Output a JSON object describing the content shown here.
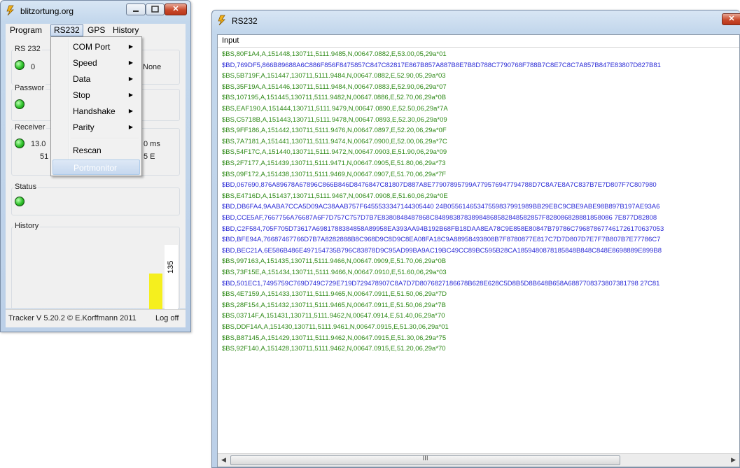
{
  "main_window": {
    "title": "blitzortung.org",
    "menu": [
      "Program",
      "RS232",
      "GPS",
      "History"
    ],
    "groups": {
      "rs232": {
        "label": "RS 232",
        "value_partial": "0",
        "value_right": "None"
      },
      "password": {
        "label": "Passwor"
      },
      "receiver": {
        "label": "Receiver",
        "line1_left": "13.0",
        "line1_right": "0 ms",
        "line2_left": "51",
        "line2_right": "5 E"
      },
      "status": {
        "label": "Status"
      },
      "history": {
        "label": "History",
        "bar_value": "135"
      }
    },
    "status_bar": {
      "version": "Tracker V 5.20.2 © E.Korffmann 2011",
      "logoff": "Log off"
    }
  },
  "rs232_menu": [
    {
      "label": "COM Port",
      "submenu": true
    },
    {
      "label": "Speed",
      "submenu": true
    },
    {
      "label": "Data",
      "submenu": true
    },
    {
      "label": "Stop",
      "submenu": true
    },
    {
      "label": "Handshake",
      "submenu": true
    },
    {
      "label": "Parity",
      "submenu": true
    },
    {
      "label": "Rescan",
      "submenu": false
    },
    {
      "label": "Portmonitor",
      "submenu": false,
      "highlighted": true
    }
  ],
  "port_monitor": {
    "title": "RS232",
    "column_header": "Input",
    "lines": [
      {
        "type": "BS",
        "text": "$BS,80F1A4,A,151448,130711,5111.9485,N,00647.0882,E,53.00,05,29a*01"
      },
      {
        "type": "BD",
        "text": "$BD,769DF5,866B89688A6C886F856F8475857C847C82817E867B857A887B8E7B8D788C7790768F788B7C8E7C8C7A857B847E83807D827B81"
      },
      {
        "type": "BS",
        "text": "$BS,5B719F,A,151447,130711,5111.9484,N,00647.0882,E,52.90,05,29a*03"
      },
      {
        "type": "BS",
        "text": "$BS,35F19A,A,151446,130711,5111.9484,N,00647.0883,E,52.90,06,29a*07"
      },
      {
        "type": "BS",
        "text": "$BS,107195,A,151445,130711,5111.9482,N,00647.0886,E,52.70,06,29a*0B"
      },
      {
        "type": "BS",
        "text": "$BS,EAF190,A,151444,130711,5111.9479,N,00647.0890,E,52.50,06,29a*7A"
      },
      {
        "type": "BS",
        "text": "$BS,C5718B,A,151443,130711,5111.9478,N,00647.0893,E,52.30,06,29a*09"
      },
      {
        "type": "BS",
        "text": "$BS,9FF186,A,151442,130711,5111.9476,N,00647.0897,E,52.20,06,29a*0F"
      },
      {
        "type": "BS",
        "text": "$BS,7A7181,A,151441,130711,5111.9474,N,00647.0900,E,52.00,06,29a*7C"
      },
      {
        "type": "BS",
        "text": "$BS,54F17C,A,151440,130711,5111.9472,N,00647.0903,E,51.90,06,29a*09"
      },
      {
        "type": "BS",
        "text": "$BS,2F7177,A,151439,130711,5111.9471,N,00647.0905,E,51.80,06,29a*73"
      },
      {
        "type": "BS",
        "text": "$BS,09F172,A,151438,130711,5111.9469,N,00647.0907,E,51.70,06,29a*7F"
      },
      {
        "type": "BD",
        "text": "$BD,067690,876A89678A67896C866B846D8476847C81807D887A8E77907895799A779576947794788D7C8A7E8A7C837B7E7D807F7C807980"
      },
      {
        "type": "BS",
        "text": "$BS,E4716D,A,151437,130711,5111.9467,N,00647.0908,E,51.60,06,29a*0E"
      },
      {
        "type": "BD",
        "text": "$BD,DB6FA4,9AABA7CCA5D09AC38AAB757F6455533347144305440 24B05561465347559837991989BB29EBC9CBE9ABE98B897B197AE93A6"
      },
      {
        "type": "BD",
        "text": "$BD,CCE5AF,7667756A76687A6F7D757C757D7B7E8380848487868C84898387838984868582848582857F828086828881858086 7E877D82808"
      },
      {
        "type": "BD",
        "text": "$BD,C2F584,705F705D73617A6981788384858A89958EA393AA94B192B68FB18DAA8EA78C9E858E80847B79786C796878677461726170637053"
      },
      {
        "type": "BD",
        "text": "$BD,BFE94A,76687467766D7B7A8282888B8C968D9C8D9C8EA08FA18C9A88958493808B7F8780877E817C7D7D807D7E7F7B807B7E77786C7"
      },
      {
        "type": "BD",
        "text": "$BD,BEC21A,6E586B486E497154735B796C83878D9C95AD99BA9AC19BC49CC89BC595B28CA1859480878185848B848C848E8698889E899B8"
      },
      {
        "type": "BS",
        "text": "$BS,997163,A,151435,130711,5111.9466,N,00647.0909,E,51.70,06,29a*0B"
      },
      {
        "type": "BS",
        "text": "$BS,73F15E,A,151434,130711,5111.9466,N,00647.0910,E,51.60,06,29a*03"
      },
      {
        "type": "BD",
        "text": "$BD,501EC1,7495759C769D749C729E719D729478907C8A7D7D8076827186678B628E628C5D8B5D8B648B658A6887708373807381798 27C81"
      },
      {
        "type": "BS",
        "text": "$BS,4E7159,A,151433,130711,5111.9465,N,00647.0911,E,51.50,06,29a*7D"
      },
      {
        "type": "BS",
        "text": "$BS,28F154,A,151432,130711,5111.9465,N,00647.0911,E,51.50,06,29a*7B"
      },
      {
        "type": "BS",
        "text": "$BS,03714F,A,151431,130711,5111.9462,N,00647.0914,E,51.40,06,29a*70"
      },
      {
        "type": "BS",
        "text": "$BS,DDF14A,A,151430,130711,5111.9461,N,00647.0915,E,51.30,06,29a*01"
      },
      {
        "type": "BS",
        "text": "$BS,B87145,A,151429,130711,5111.9462,N,00647.0915,E,51.30,06,29a*75"
      },
      {
        "type": "BS",
        "text": "$BS,92F140,A,151428,130711,5111.9462,N,00647.0915,E,51.20,06,29a*70"
      }
    ],
    "scroll_grip": "III"
  },
  "colors": {
    "bs_text": "#2f8a18",
    "bd_text": "#2a2ad6",
    "led_green": "#2ec22a",
    "history_bar": "#f5ef1e"
  }
}
